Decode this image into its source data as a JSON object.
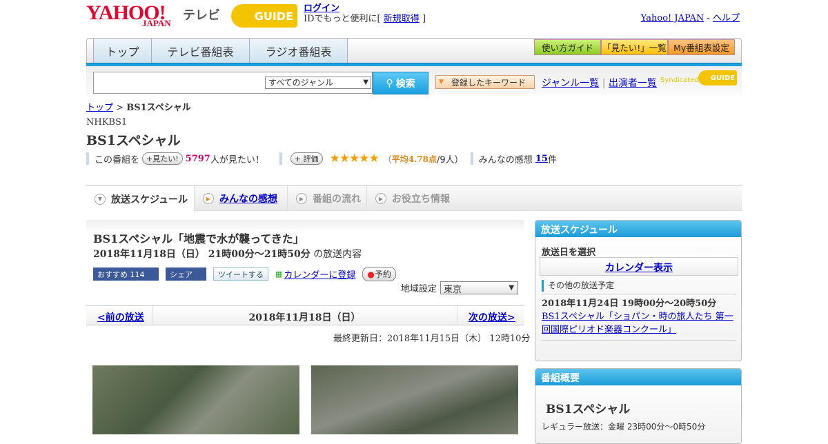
{
  "header": {
    "logo_yahoo": "YAHOO!",
    "logo_japan": "JAPAN",
    "logo_tv": "テレビ",
    "logo_gguide": "GUIDE",
    "login": "ログイン",
    "id_prompt": "IDでもっと便利に[",
    "signup": "新規取得",
    "id_close": "]",
    "yahoo_japan": "Yahoo! JAPAN",
    "dash": "-",
    "help": "ヘルプ"
  },
  "nav": {
    "tabs": [
      "トップ",
      "テレビ番組表",
      "ラジオ番組表"
    ],
    "guide": "使い方ガイド",
    "wishlist": "「見たい!」一覧",
    "my_settings": "My番組表設定"
  },
  "search": {
    "genre": "すべてのジャンル",
    "button": "検索",
    "keyword": "登録したキーワード",
    "genre_list": "ジャンル一覧",
    "separator": "|",
    "cast_list": "出演者一覧",
    "syndicated": "Syndicated",
    "syndicated_logo": "GUIDE"
  },
  "breadcrumb": {
    "top": "トップ",
    "sep": ">",
    "current": "BS1スペシャル"
  },
  "program": {
    "channel": "NHKBS1",
    "title": "BS1スペシャル"
  },
  "rating": {
    "prefix": "この番組を",
    "want_btn": "+見たい!",
    "want_count": "5797",
    "want_suffix": "人が見たい！",
    "rate_btn": "+ 評価",
    "stars": "★★★★★",
    "avg_open": "（",
    "avg": "平均4.78点",
    "avg_count": "/9人）",
    "reviews_label": "みんなの感想",
    "reviews_count": "15",
    "reviews_suffix": "件",
    "rating_value": 4.78
  },
  "tabs": [
    "放送スケジュール",
    "みんなの感想",
    "番組の流れ",
    "お役立ち情報"
  ],
  "episode": {
    "title": "BS1スペシャル「地震で水が襲ってきた」",
    "datetime": "2018年11月18日（日） 21時00分～21時50分",
    "datetime_suffix": "の放送内容",
    "fb_recommend": "おすすめ 114",
    "fb_share": "シェア",
    "tweet": "ツイートする",
    "calendar": "カレンダーに登録",
    "reserve": "予約",
    "region_label": "地域設定",
    "region": "東京"
  },
  "pager": {
    "prev": "<前の放送",
    "date": "2018年11月18日（日）",
    "next": "次の放送>"
  },
  "updated": "最終更新日：2018年11月15日（木） 12時10分",
  "sidebar": {
    "schedule_title": "放送スケジュール",
    "select_date": "放送日を選択",
    "calendar": "カレンダー表示",
    "other_title": "その他の放送予定",
    "other_datetime": "2018年11月24日 19時00分～20時50分",
    "other_link": "BS1スペシャル「ショパン・時の旅人たち 第一回国際ピリオド楽器コンクール」",
    "overview_title": "番組概要",
    "overview_name": "BS1スペシャル",
    "regular": "レギュラー放送：金曜 23時00分～0時50分"
  }
}
